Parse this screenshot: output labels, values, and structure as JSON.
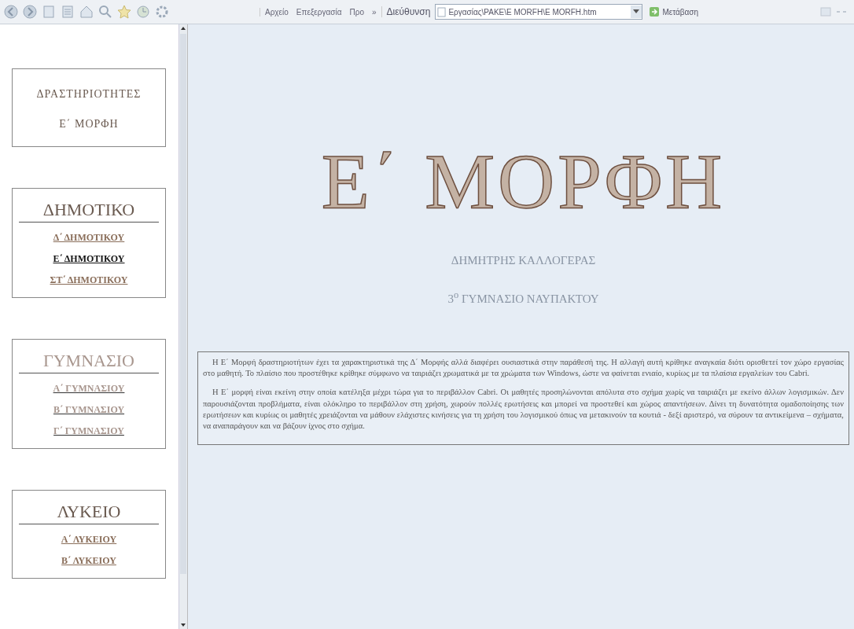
{
  "toolbar": {
    "menu": [
      "Αρχείο",
      "Επεξεργασία",
      "Προ"
    ],
    "more": "»",
    "address_label": "Διεύθυνση",
    "address": "Εργασίας\\PAKE\\E MORFH\\E MORFH.htm",
    "go": "Μετάβαση"
  },
  "sidebar": {
    "boxes": [
      {
        "kind": "title",
        "lines": [
          "ΔΡΑΣΤΗΡΙΟΤΗΤΕΣ",
          "Ε΄ ΜΟΡΦΗ"
        ]
      },
      {
        "kind": "menu",
        "heading": "ΔΗΜΟΤΙΚΟ",
        "disabled": false,
        "links": [
          {
            "label": "Δ΄ ΔΗΜΟΤΙΚΟΥ",
            "selected": false
          },
          {
            "label": "Ε΄ ΔΗΜΟΤΙΚΟΥ",
            "selected": true
          },
          {
            "label": "ΣΤ΄ ΔΗΜΟΤΙΚΟΥ",
            "selected": false
          }
        ]
      },
      {
        "kind": "menu",
        "heading": "ΓΥΜΝΑΣΙΟ",
        "disabled": true,
        "links": [
          {
            "label": "Α΄ ΓΥΜΝΑΣΙΟΥ",
            "selected": false
          },
          {
            "label": "Β΄ ΓΥΜΝΑΣΙΟΥ",
            "selected": false
          },
          {
            "label": "Γ΄ ΓΥΜΝΑΣΙΟΥ",
            "selected": false
          }
        ]
      },
      {
        "kind": "menu",
        "heading": "ΛΥΚΕΙΟ",
        "disabled": false,
        "links": [
          {
            "label": "Α΄ ΛΥΚΕΙΟΥ",
            "selected": false
          },
          {
            "label": "Β΄ ΛΥΚΕΙΟΥ",
            "selected": false
          }
        ]
      }
    ]
  },
  "main": {
    "title": "Ε΄ ΜΟΡΦΗ",
    "author": "ΔΗΜΗΤΡΗΣ ΚΑΛΛΟΓΕΡΑΣ",
    "school": "3$^{ο}$ ΓΥΜΝΑΣΙΟ ΝΑΥΠΑΚΤΟΥ",
    "paragraphs": [
      "Η Ε΄ Μορφή δραστηριοτήτων έχει τα χαρακτηριστικά της Δ΄ Μορφής αλλά διαφέρει ουσιαστικά στην παράθεσή της. Η αλλαγή αυτή κρίθηκε αναγκαία διότι ορισθετεί τον χώρο εργασίας στο μαθητή. Το πλαίσιο που προστέθηκε κρίθηκε σύμφωνο να ταιριάζει χρωματικά με τα χρώματα των Windows, ώστε να φαίνεται ενιαίο, κυρίως με τα πλαίσια εργαλείων του Cabri.",
      "Η Ε΄ μορφή είναι εκείνη στην οποία κατέληξα μέχρι τώρα για το περιβάλλον Cabri. Οι μαθητές προσηλώνονται απόλυτα στο σχήμα χωρίς να ταιριάζει με εκείνο άλλων λογισμικών. Δεν παρουσιάζονται προβλήματα, είναι ολόκληρο το περιβάλλον στη χρήση, χωρούν πολλές ερωτήσεις και μπορεί να προστεθεί και χώρος απαντήσεων. Δίνει τη δυνατότητα ομαδοποίησης των ερωτήσεων και κυρίως οι μαθητές χρειάζονται να μάθουν ελάχιστες κινήσεις για τη χρήση του λογισμικού όπως να μετακινούν τα κουτιά - δεξί αριστερό, να σύρουν τα αντικείμενα – σχήματα, να αναπαράγουν και να βάζουν ίχνος στο σχήμα."
    ]
  }
}
